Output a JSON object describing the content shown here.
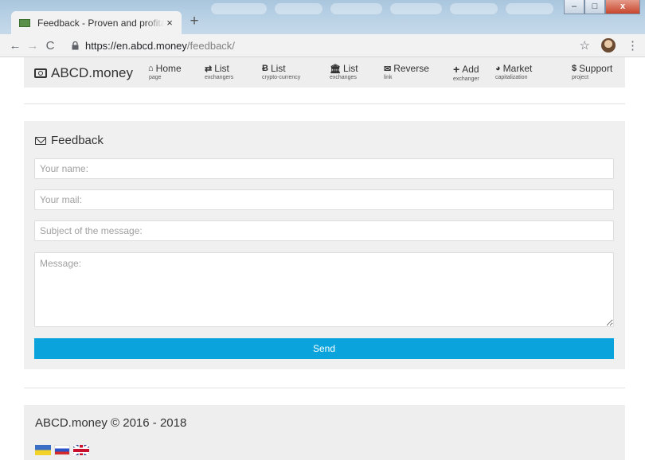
{
  "browser": {
    "tab_title": "Feedback - Proven and profitable exchangers",
    "tab_close": "×",
    "new_tab": "+",
    "url_host": "https://en.abcd.money",
    "url_path": "/feedback/",
    "back": "←",
    "forward": "→",
    "reload": "C",
    "star": "☆",
    "menu": "⋮",
    "window_controls": {
      "minimize": "‒",
      "maximize": "□",
      "close": "x"
    }
  },
  "site": {
    "brand": "ABCD.money",
    "nav": [
      {
        "icon": "⌂",
        "label": "Home",
        "sub": "page"
      },
      {
        "icon": "⇄",
        "label": "List",
        "sub": "exchangers"
      },
      {
        "icon": "Ƀ",
        "label": "List",
        "sub": "crypto-currency"
      },
      {
        "icon": "🏛",
        "label": "List",
        "sub": "exchanges"
      },
      {
        "icon": "✉",
        "label": "Reverse",
        "sub": "link"
      },
      {
        "icon": "+",
        "label": "Add",
        "sub": "exchanger"
      },
      {
        "icon": "◕",
        "label": "Market",
        "sub": "capitalization"
      },
      {
        "icon": "$",
        "label": "Support",
        "sub": "project"
      }
    ]
  },
  "feedback": {
    "heading": "Feedback",
    "name_placeholder": "Your name:",
    "mail_placeholder": "Your mail:",
    "subject_placeholder": "Subject of the message:",
    "message_placeholder": "Message:",
    "send_label": "Send"
  },
  "footer": {
    "copyright": "ABCD.money © 2016 - 2018"
  },
  "colors": {
    "accent": "#0aa3dc",
    "panel_bg": "#f0f0f0",
    "nav_bg": "#eeeeee"
  }
}
